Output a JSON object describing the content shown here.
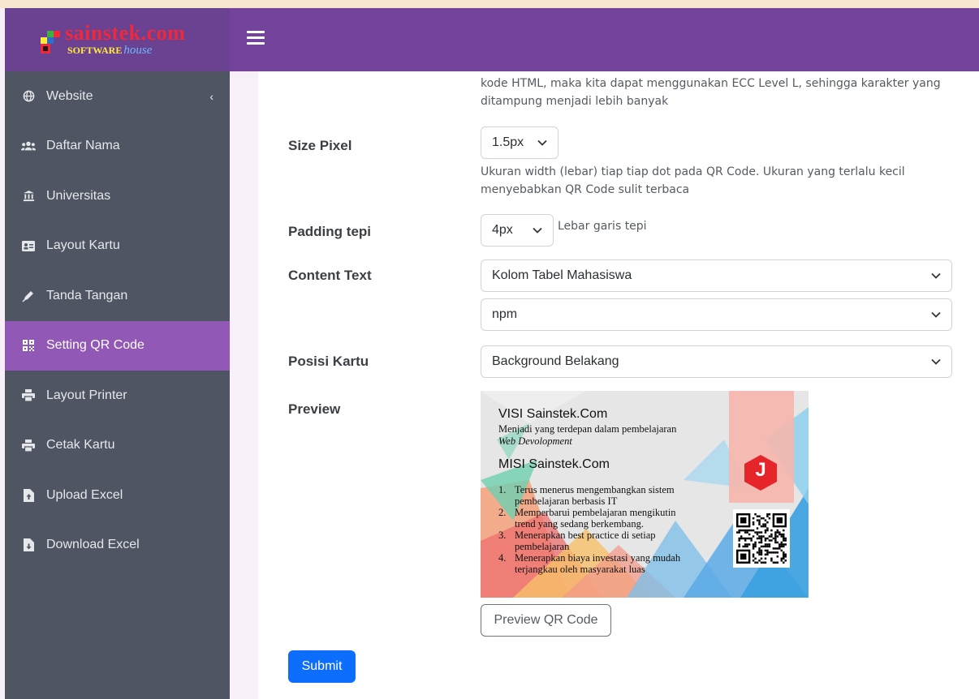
{
  "brand": {
    "name": "sainstek.com",
    "sub_bold": "SOFTWARE",
    "sub_italic": "house"
  },
  "sidebar": {
    "items": [
      {
        "label": "Website",
        "icon": "globe-icon",
        "has_chevron": true,
        "chevron": "‹"
      },
      {
        "label": "Daftar Nama",
        "icon": "users-icon"
      },
      {
        "label": "Universitas",
        "icon": "university-icon"
      },
      {
        "label": "Layout Kartu",
        "icon": "id-card-icon"
      },
      {
        "label": "Tanda Tangan",
        "icon": "signature-icon"
      },
      {
        "label": "Setting QR Code",
        "icon": "qrcode-icon",
        "active": true
      },
      {
        "label": "Layout Printer",
        "icon": "printer-icon"
      },
      {
        "label": "Cetak Kartu",
        "icon": "printer-icon"
      },
      {
        "label": "Upload Excel",
        "icon": "file-upload-icon"
      },
      {
        "label": "Download Excel",
        "icon": "file-download-icon"
      }
    ]
  },
  "form": {
    "ecc_help_line1": "kode HTML, maka kita dapat menggunakan ECC Level L, sehingga karakter yang",
    "ecc_help_line2": "ditampung menjadi lebih banyak",
    "size_pixel": {
      "label": "Size Pixel",
      "value": "1.5px",
      "help_line1": "Ukuran width (lebar) tiap tiap dot pada QR Code. Ukuran yang terlalu kecil",
      "help_line2": "menyebabkan QR Code sulit terbaca"
    },
    "padding": {
      "label": "Padding tepi",
      "value": "4px",
      "help": "Lebar garis tepi"
    },
    "content_text": {
      "label": "Content Text",
      "value": "Kolom Tabel Mahasiswa",
      "value2": "npm"
    },
    "posisi": {
      "label": "Posisi Kartu",
      "value": "Background Belakang"
    },
    "preview": {
      "label": "Preview"
    },
    "preview_button": "Preview QR Code",
    "submit_button": "Submit"
  },
  "card": {
    "visi_title": "VISI Sainstek.Com",
    "visi_text": "Menjadi yang terdepan dalam pembelajaran",
    "visi_italic": "Web Devolopment",
    "misi_title": "MISI Sainstek.Com",
    "misi_items": [
      {
        "num": "1.",
        "line1": "Terus menerus mengembangkan sistem",
        "line2": "pembelajaran berbasis IT"
      },
      {
        "num": "2.",
        "line1": "Memperbarui pembelajaran mengikutin",
        "line2": "trend yang sedang berkembang."
      },
      {
        "num": "3.",
        "line1": "Menerapkan best practice di setiap",
        "line2": "pembelajaran"
      },
      {
        "num": "4.",
        "line1": "Menerapkan biaya investasi yang mudah",
        "line2": "terjangkau oleh masyarakat luas"
      }
    ],
    "logo_letter": "J"
  },
  "colors": {
    "topbar": "#74439b",
    "sidebar": "#4f5562",
    "active": "#9158b6",
    "primary": "#0d6efd"
  }
}
